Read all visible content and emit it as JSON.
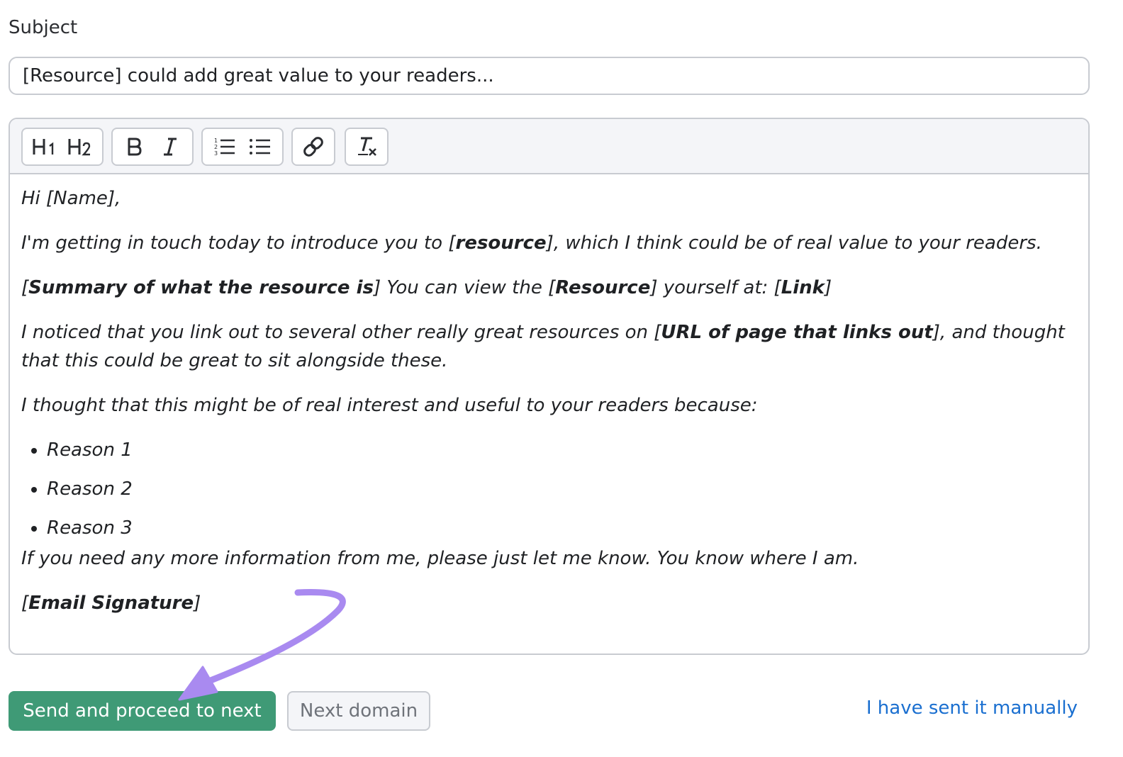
{
  "subject": {
    "label": "Subject",
    "value": "[Resource] could add great value to your readers..."
  },
  "toolbar": {
    "groups": [
      [
        "h1-icon",
        "h2-icon"
      ],
      [
        "bold-icon",
        "italic-icon"
      ],
      [
        "ordered-list-icon",
        "bullet-list-icon"
      ],
      [
        "link-icon"
      ],
      [
        "clear-format-icon"
      ]
    ]
  },
  "email": {
    "greeting": "Hi [Name],",
    "p1": {
      "a": "I'm getting in touch today to introduce you to [",
      "b": "resource",
      "c": "], which I think could be of real value to your readers."
    },
    "p2": {
      "a": "[",
      "b": "Summary of what the resource is",
      "c": "] You can view the [",
      "d": "Resource",
      "e": "] yourself at: [",
      "f": "Link",
      "g": "]"
    },
    "p3": {
      "a": "I noticed that you link out to several other really great resources on [",
      "b": "URL of page that links out",
      "c": "], and thought that this could be great to sit alongside these."
    },
    "p4": "I thought that this might be of real interest and useful to your readers because:",
    "reasons": [
      "Reason 1",
      "Reason 2",
      "Reason 3"
    ],
    "p5": "If you need any more information from me, please just let me know. You know where I am.",
    "signature": {
      "a": "[",
      "b": "Email Signature",
      "c": "]"
    }
  },
  "actions": {
    "send_label": "Send and proceed to next",
    "next_label": "Next domain",
    "manual_label": "I have sent it manually"
  },
  "colors": {
    "send_button": "#3f9a76",
    "link": "#1a6fd0",
    "annotation_arrow": "#a98af0"
  }
}
